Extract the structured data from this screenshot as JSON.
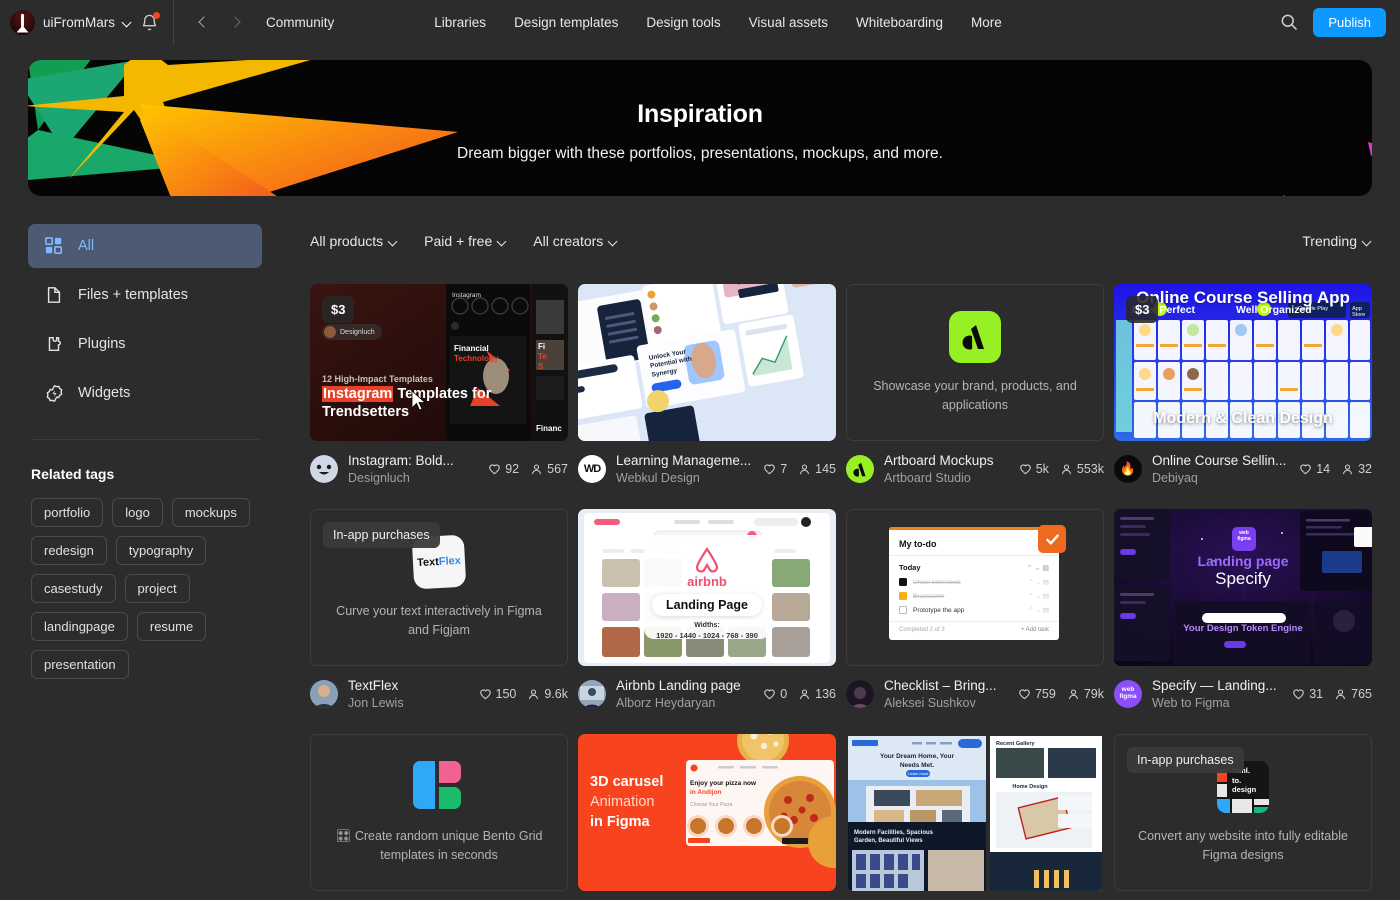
{
  "topbar": {
    "avatar_icon": "mars-avatar",
    "username": "uiFromMars",
    "user_chevron_icon": "chevron-down-icon",
    "notifications_icon": "bell-icon",
    "back_icon": "chevron-left-icon",
    "forward_icon": "chevron-right-icon",
    "breadcrumb": "Community",
    "menu": [
      {
        "label": "Libraries"
      },
      {
        "label": "Design templates"
      },
      {
        "label": "Design tools"
      },
      {
        "label": "Visual assets"
      },
      {
        "label": "Whiteboarding"
      },
      {
        "label": "More"
      }
    ],
    "search_icon": "search-icon",
    "publish_label": "Publish",
    "publish_color": "#0d99ff"
  },
  "hero": {
    "title": "Inspiration",
    "subtitle": "Dream bigger with these portfolios, presentations, mockups, and more.",
    "background_color": "#050505"
  },
  "sidebar": {
    "items": [
      {
        "label": "All",
        "icon": "grid-icon",
        "active": true
      },
      {
        "label": "Files + templates",
        "icon": "file-icon",
        "active": false
      },
      {
        "label": "Plugins",
        "icon": "plugin-icon",
        "active": false
      },
      {
        "label": "Widgets",
        "icon": "widget-icon",
        "active": false
      }
    ],
    "related_tags_title": "Related tags",
    "tags": [
      "portfolio",
      "logo",
      "mockups",
      "redesign",
      "typography",
      "casestudy",
      "project",
      "landingpage",
      "resume",
      "presentation"
    ]
  },
  "filters": {
    "products": "All products",
    "price": "Paid + free",
    "creators": "All creators",
    "sort": "Trending",
    "chevron_icon": "chevron-down-icon"
  },
  "cards": [
    {
      "title": "Instagram: Bold...",
      "author": "Designluch",
      "likes": "92",
      "users": "567",
      "badge": "$3",
      "badge_type": "price",
      "thumb_kind": "instagram-templates",
      "thumb_texts": {
        "eyebrow": "12 High-Impact Templates",
        "headline_a": "Instagram",
        "headline_b": " Templates for",
        "headline_c": "Trendsetters",
        "phone_label": "Instagram",
        "phone_title_a": "Financial",
        "phone_title_b": "Technology",
        "side_a": "Fi",
        "side_b": "Te",
        "side_c": "S",
        "side_foot": "Financ"
      }
    },
    {
      "title": "Learning Manageme...",
      "author": "Webkul Design",
      "likes": "7",
      "users": "145",
      "badge": "",
      "badge_type": "none",
      "thumb_kind": "lms-dashboard",
      "thumb_texts": {
        "headline": "Unlock Your Potential with Synergy"
      }
    },
    {
      "title": "Artboard Mockups",
      "author": "Artboard Studio",
      "likes": "5k",
      "users": "553k",
      "badge": "",
      "badge_type": "none",
      "thumb_kind": "plugin",
      "thumb_texts": {
        "caption": "Showcase your brand, products, and applications"
      },
      "icon_color": "#97f024"
    },
    {
      "title": "Online Course Sellin...",
      "author": "Debiyaq",
      "likes": "14",
      "users": "32",
      "badge": "$3",
      "badge_type": "price",
      "thumb_kind": "course-app",
      "thumb_texts": {
        "headline": "Online Course Selling App",
        "feat_a": "Pixel Perfect",
        "feat_b": "Well Organized",
        "store_a": "Google Play",
        "store_b": "App Store",
        "footer": "Modern & Clean Design"
      }
    },
    {
      "title": "TextFlex",
      "author": "Jon Lewis",
      "likes": "150",
      "users": "9.6k",
      "badge": "In-app purchases",
      "badge_type": "inapp",
      "thumb_kind": "plugin",
      "thumb_texts": {
        "caption": "Curve your text interactively in Figma and Figjam",
        "logo_a": "Text",
        "logo_b": "Flex"
      },
      "icon_color": "#f4f4f4"
    },
    {
      "title": "Airbnb Landing page",
      "author": "Alborz Heydaryan",
      "likes": "0",
      "users": "136",
      "badge": "",
      "badge_type": "none",
      "thumb_kind": "airbnb",
      "thumb_texts": {
        "brand": "airbnb",
        "label": "Landing Page",
        "widths_title": "Widths:",
        "widths": "1920 - 1440 - 1024 - 768 - 390"
      }
    },
    {
      "title": "Checklist – Bring...",
      "author": "Aleksei Sushkov",
      "likes": "759",
      "users": "79k",
      "badge": "",
      "badge_type": "none",
      "thumb_kind": "checklist",
      "thumb_texts": {
        "card_title": "My to-do",
        "section": "Today",
        "item_1": "Union interviews",
        "item_2": "Brainstorm",
        "item_3": "Prototype the app",
        "footer": "Completed 2 of 3",
        "add": "+ Add task"
      }
    },
    {
      "title": "Specify — Landing...",
      "author": "Web to Figma",
      "likes": "31",
      "users": "765",
      "badge": "",
      "badge_type": "none",
      "thumb_kind": "specify",
      "thumb_texts": {
        "logo_a": "web",
        "logo_b": "figma",
        "headline_a": "Landing page",
        "headline_b": "Specify",
        "sub": "Your Design Token Engine"
      }
    },
    {
      "title": "",
      "author": "",
      "likes": "",
      "users": "",
      "badge": "",
      "badge_type": "none",
      "thumb_kind": "plugin",
      "thumb_texts": {
        "caption": "🎛 Create random unique Bento Grid templates in seconds"
      },
      "icon_color": "#4db2ff"
    },
    {
      "title": "",
      "author": "",
      "likes": "",
      "users": "",
      "badge": "",
      "badge_type": "none",
      "thumb_kind": "pizza-carousel",
      "thumb_texts": {
        "line_a": "3D carusel",
        "line_b": "Animation",
        "line_c": "in Figma",
        "site_a": "Enjoy your pizza now",
        "site_b": "in Andijon",
        "site_c": "Choose Your Pizza"
      }
    },
    {
      "title": "",
      "author": "",
      "likes": "",
      "users": "",
      "badge": "",
      "badge_type": "none",
      "thumb_kind": "realestate",
      "thumb_texts": {
        "hero_a": "Your Dream Home, Your",
        "hero_b": "Needs Met.",
        "cta": "Learn more",
        "dark_a": "Modern Facilities, Spacious",
        "dark_b": "Garden, Beautiful Views",
        "right_a": "Recent Gallery",
        "right_b": "Home Design"
      }
    },
    {
      "title": "",
      "author": "",
      "likes": "",
      "users": "",
      "badge": "In-app purchases",
      "badge_type": "inapp",
      "thumb_kind": "plugin",
      "thumb_texts": {
        "caption": "Convert any website into fully editable Figma designs",
        "logo_a": "html.",
        "logo_b": "to.",
        "logo_c": "design"
      },
      "icon_color": "#151515"
    }
  ]
}
